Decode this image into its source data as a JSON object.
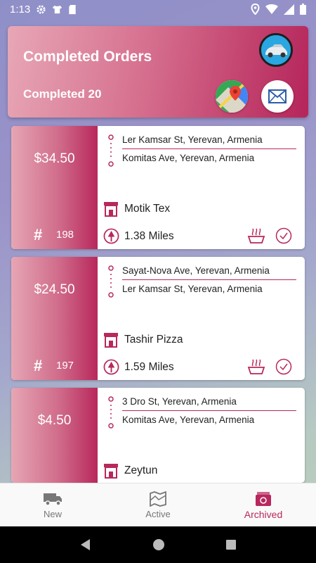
{
  "status_bar": {
    "time": "1:13"
  },
  "header": {
    "title": "Completed Orders",
    "subtitle": "Completed 20",
    "avatar": "car-avatar",
    "maps_icon": "maps-icon",
    "mail_icon": "mail-icon"
  },
  "orders": [
    {
      "price": "$34.50",
      "hash": "#",
      "number": "198",
      "pickup": "Ler Kamsar St, Yerevan, Armenia",
      "dropoff": "Komitas Ave, Yerevan, Armenia",
      "store": "Motik Tex",
      "distance": "1.38 Miles"
    },
    {
      "price": "$24.50",
      "hash": "#",
      "number": "197",
      "pickup": "Sayat-Nova Ave, Yerevan, Armenia",
      "dropoff": "Ler Kamsar St, Yerevan, Armenia",
      "store": "Tashir Pizza",
      "distance": "1.59 Miles"
    },
    {
      "price": "$4.50",
      "hash": "#",
      "number": "",
      "pickup": "3 Dro St, Yerevan, Armenia",
      "dropoff": "Komitas Ave, Yerevan, Armenia",
      "store": "Zeytun",
      "distance": ""
    }
  ],
  "nav": {
    "items": [
      {
        "label": "New",
        "icon": "delivery-truck-icon"
      },
      {
        "label": "Active",
        "icon": "map-icon"
      },
      {
        "label": "Archived",
        "icon": "archive-box-icon"
      }
    ],
    "active": "Archived"
  },
  "colors": {
    "accent": "#b8285c",
    "header_start": "#e7a7b6",
    "header_end": "#b5255b"
  }
}
